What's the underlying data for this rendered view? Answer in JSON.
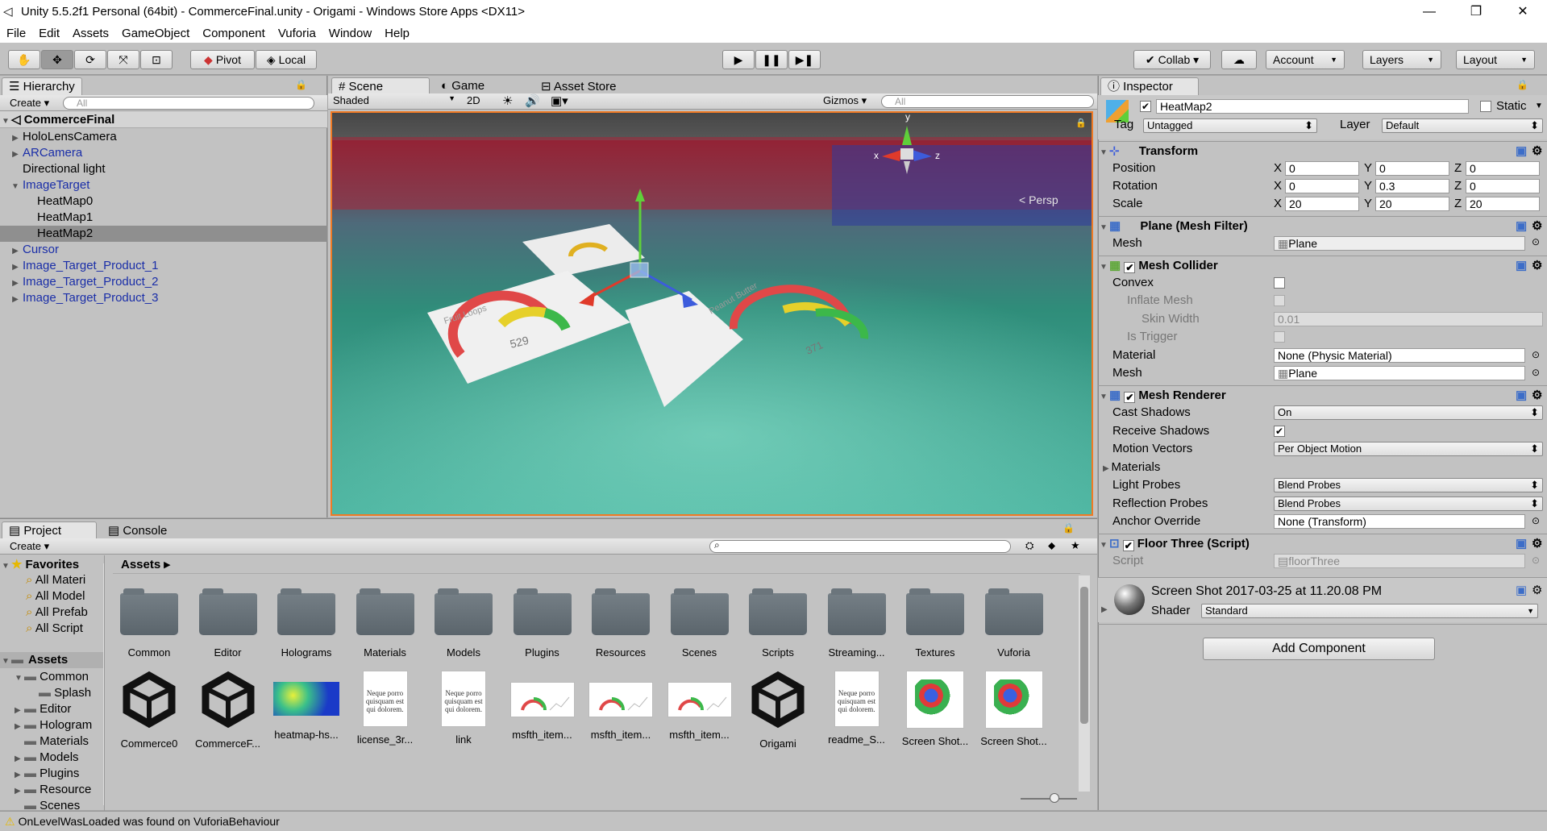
{
  "window": {
    "title": "Unity 5.5.2f1 Personal (64bit) - CommerceFinal.unity - Origami - Windows Store Apps <DX11>",
    "minimize": "—",
    "maximize": "❐",
    "close": "✕"
  },
  "menu": [
    "File",
    "Edit",
    "Assets",
    "GameObject",
    "Component",
    "Vuforia",
    "Window",
    "Help"
  ],
  "toolbar": {
    "pivot": "Pivot",
    "local": "Local",
    "collab": "Collab ▾",
    "account": "Account",
    "layers": "Layers",
    "layout": "Layout"
  },
  "hierarchy": {
    "tab": "Hierarchy",
    "create": "Create ▾",
    "search": "All",
    "scene": "CommerceFinal",
    "items": [
      {
        "label": "HoloLensCamera",
        "indent": 1,
        "arrow": "▶",
        "blue": false
      },
      {
        "label": "ARCamera",
        "indent": 1,
        "arrow": "▶",
        "blue": true
      },
      {
        "label": "Directional light",
        "indent": 1,
        "arrow": "",
        "blue": false
      },
      {
        "label": "ImageTarget",
        "indent": 1,
        "arrow": "▼",
        "blue": true
      },
      {
        "label": "HeatMap0",
        "indent": 2,
        "arrow": "",
        "blue": false
      },
      {
        "label": "HeatMap1",
        "indent": 2,
        "arrow": "",
        "blue": false
      },
      {
        "label": "HeatMap2",
        "indent": 2,
        "arrow": "",
        "blue": false,
        "selected": true
      },
      {
        "label": "Cursor",
        "indent": 1,
        "arrow": "▶",
        "blue": true
      },
      {
        "label": "Image_Target_Product_1",
        "indent": 1,
        "arrow": "▶",
        "blue": true
      },
      {
        "label": "Image_Target_Product_2",
        "indent": 1,
        "arrow": "▶",
        "blue": true
      },
      {
        "label": "Image_Target_Product_3",
        "indent": 1,
        "arrow": "▶",
        "blue": true
      }
    ]
  },
  "scene": {
    "tabs": [
      "Scene",
      "Game",
      "Asset Store"
    ],
    "shaded": "Shaded",
    "mode2d": "2D",
    "gizmos": "Gizmos ▾",
    "search": "All",
    "persp": "Persp",
    "axis": {
      "x": "x",
      "y": "y",
      "z": "z"
    },
    "card_labels": [
      "Fruit Loops",
      "Peanut Butter"
    ],
    "gauge_values": [
      "529",
      "371"
    ]
  },
  "inspector": {
    "tab": "Inspector",
    "object": "HeatMap2",
    "static": "Static",
    "tag_label": "Tag",
    "tag": "Untagged",
    "layer_label": "Layer",
    "layer": "Default",
    "transform": {
      "title": "Transform",
      "rows": [
        {
          "label": "Position",
          "x": "0",
          "y": "0",
          "z": "0"
        },
        {
          "label": "Rotation",
          "x": "0",
          "y": "0.3",
          "z": "0"
        },
        {
          "label": "Scale",
          "x": "20",
          "y": "20",
          "z": "20"
        }
      ]
    },
    "meshfilter": {
      "title": "Plane (Mesh Filter)",
      "mesh_label": "Mesh",
      "mesh": "Plane"
    },
    "collider": {
      "title": "Mesh Collider",
      "convex": "Convex",
      "inflate": "Inflate Mesh",
      "skin": "Skin Width",
      "skin_value": "0.01",
      "trigger": "Is Trigger",
      "material_label": "Material",
      "material": "None (Physic Material)",
      "mesh_label": "Mesh",
      "mesh": "Plane"
    },
    "renderer": {
      "title": "Mesh Renderer",
      "cast": "Cast Shadows",
      "cast_value": "On",
      "receive": "Receive Shadows",
      "motion": "Motion Vectors",
      "motion_value": "Per Object Motion",
      "materials": "Materials",
      "light": "Light Probes",
      "light_value": "Blend Probes",
      "reflection": "Reflection Probes",
      "reflection_value": "Blend Probes",
      "anchor": "Anchor Override",
      "anchor_value": "None (Transform)"
    },
    "script": {
      "title": "Floor Three (Script)",
      "label": "Script",
      "value": "floorThree"
    },
    "material": {
      "name": "Screen Shot 2017-03-25 at 11.20.08 PM",
      "shader_label": "Shader",
      "shader": "Standard"
    },
    "add": "Add Component"
  },
  "project": {
    "tabs": [
      "Project",
      "Console"
    ],
    "create": "Create ▾",
    "favorites": "Favorites",
    "fav_items": [
      "All Materi",
      "All Model",
      "All Prefab",
      "All Script"
    ],
    "assets": "Assets",
    "tree": [
      {
        "label": "Common",
        "arrow": "▼",
        "indent": 1
      },
      {
        "label": "Splash",
        "arrow": "",
        "indent": 2
      },
      {
        "label": "Editor",
        "arrow": "▶",
        "indent": 1
      },
      {
        "label": "Hologram",
        "arrow": "▶",
        "indent": 1
      },
      {
        "label": "Materials",
        "arrow": "",
        "indent": 1
      },
      {
        "label": "Models",
        "arrow": "▶",
        "indent": 1
      },
      {
        "label": "Plugins",
        "arrow": "▶",
        "indent": 1
      },
      {
        "label": "Resource",
        "arrow": "▶",
        "indent": 1
      },
      {
        "label": "Scenes",
        "arrow": "",
        "indent": 1
      }
    ],
    "breadcrumb": "Assets ▸",
    "folders": [
      "Common",
      "Editor",
      "Holograms",
      "Materials",
      "Models",
      "Plugins",
      "Resources",
      "Scenes",
      "Scripts",
      "Streaming...",
      "Textures",
      "Vuforia"
    ],
    "files": [
      {
        "label": "Commerce0",
        "kind": "unity"
      },
      {
        "label": "CommerceF...",
        "kind": "unity"
      },
      {
        "label": "heatmap-hs...",
        "kind": "heat"
      },
      {
        "label": "license_3r...",
        "kind": "doc"
      },
      {
        "label": "link",
        "kind": "doc"
      },
      {
        "label": "msfth_item...",
        "kind": "card"
      },
      {
        "label": "msfth_item...",
        "kind": "card"
      },
      {
        "label": "msfth_item...",
        "kind": "card"
      },
      {
        "label": "Origami",
        "kind": "unity"
      },
      {
        "label": "readme_S...",
        "kind": "doc"
      },
      {
        "label": "Screen Shot...",
        "kind": "shot"
      },
      {
        "label": "Screen Shot...",
        "kind": "shot"
      }
    ],
    "doc_text": "Neque porro quisquam est qui dolorem."
  },
  "status": {
    "text": "OnLevelWasLoaded was found on VuforiaBehaviour"
  }
}
